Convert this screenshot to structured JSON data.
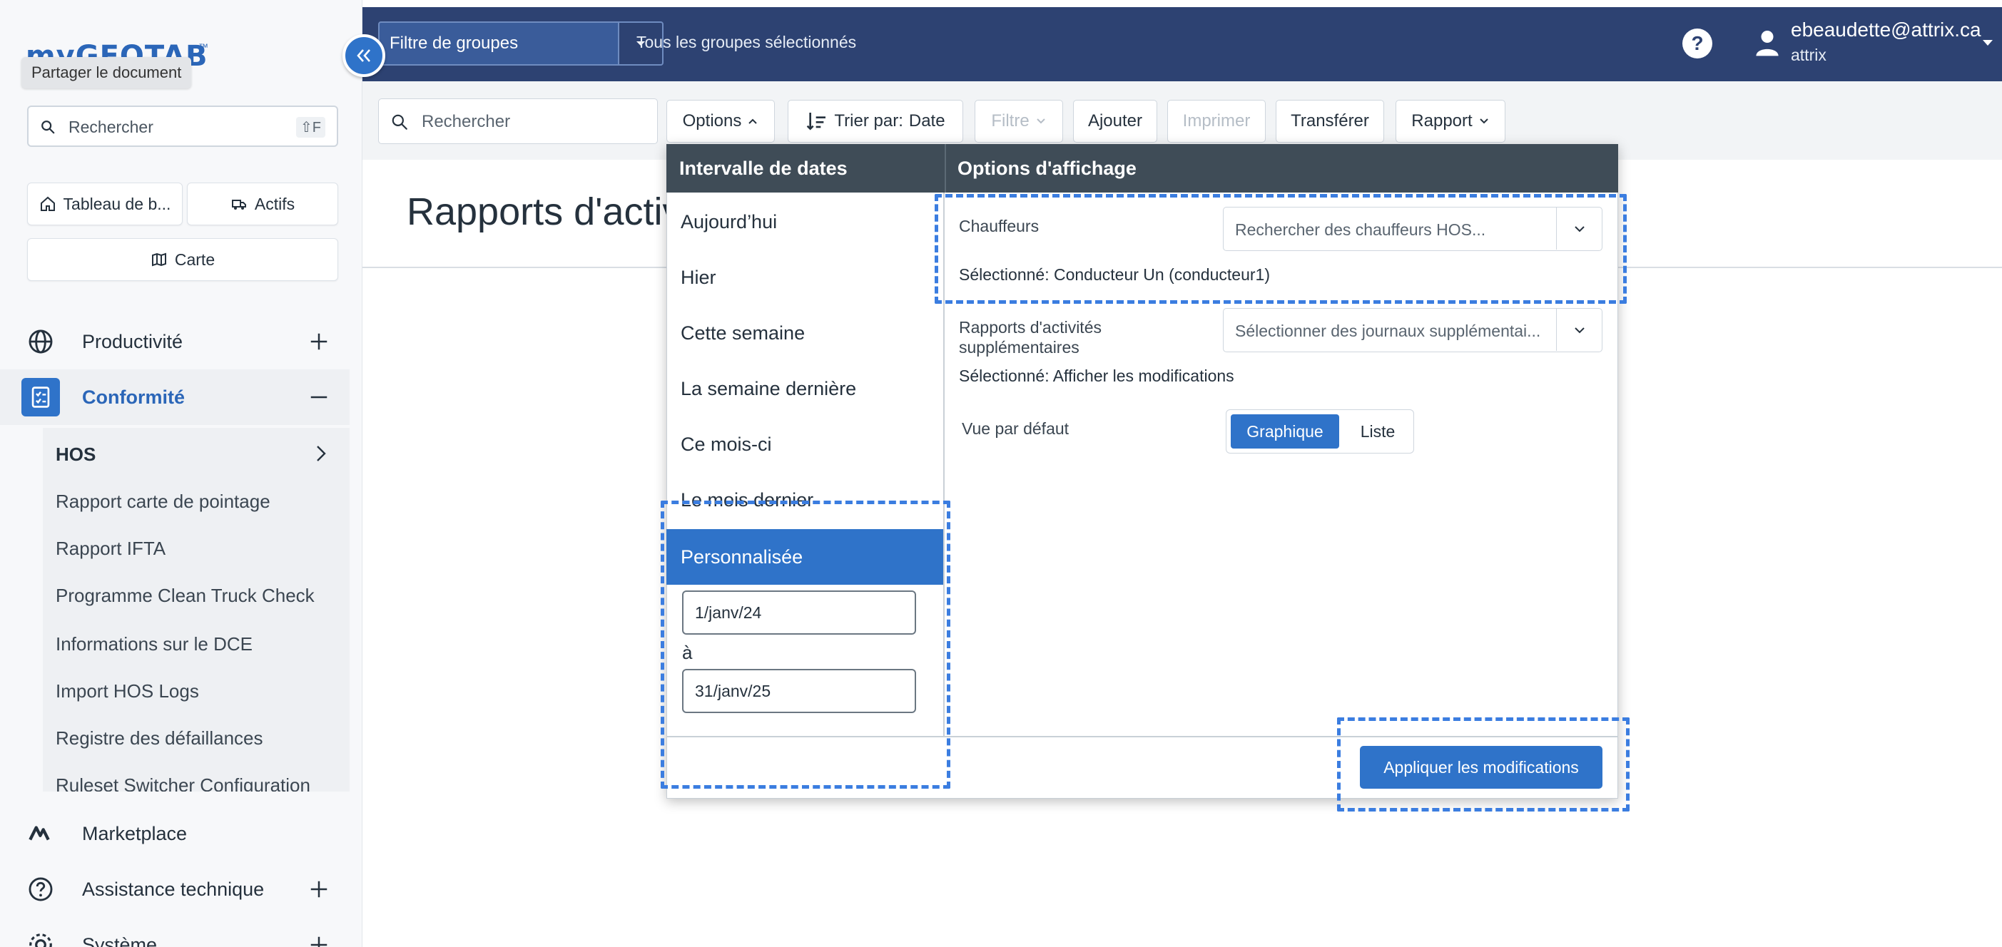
{
  "sidebar": {
    "logo": "myGEOTAB",
    "logo_tm": "™",
    "share_tooltip": "Partager le document",
    "search": {
      "placeholder": "Rechercher",
      "shortcut": "⇧F"
    },
    "quick": {
      "dashboard": "Tableau de b...",
      "assets": "Actifs",
      "map": "Carte"
    },
    "nav": {
      "productivity": "Productivité",
      "compliance": "Conformité",
      "marketplace": "Marketplace",
      "support": "Assistance technique",
      "system": "Système"
    },
    "compliance_items": [
      "HOS",
      "Rapport carte de pointage",
      "Rapport IFTA",
      "Programme Clean Truck Check",
      "Informations sur le DCE",
      "Import HOS Logs",
      "Registre des défaillances",
      "Ruleset Switcher Configuration"
    ]
  },
  "topbar": {
    "group_filter": "Filtre de groupes",
    "group_status": "Tous les groupes sélectionnés",
    "help": "?",
    "user_email": "ebeaudette@attrix.ca",
    "user_db": "attrix"
  },
  "toolbar": {
    "search_placeholder": "Rechercher",
    "options": "Options",
    "sort_label": "Trier par:",
    "sort_value": "Date",
    "filter": "Filtre",
    "add": "Ajouter",
    "print": "Imprimer",
    "transfer": "Transférer",
    "report": "Rapport"
  },
  "page": {
    "title": "Rapports d'activ"
  },
  "options_panel": {
    "date_header": "Intervalle de dates",
    "display_header": "Options d'affichage",
    "dates": [
      "Aujourd’hui",
      "Hier",
      "Cette semaine",
      "La semaine dernière",
      "Ce mois-ci",
      "Le mois dernier",
      "Personnalisée"
    ],
    "from": "1/janv/24",
    "to_label": "à",
    "to": "31/janv/25",
    "drivers_label": "Chauffeurs",
    "drivers_placeholder": "Rechercher des chauffeurs HOS...",
    "drivers_selected": "Sélectionné: Conducteur Un (conducteur1)",
    "extra_label_1": "Rapports d'activités",
    "extra_label_2": "supplémentaires",
    "extra_placeholder": "Sélectionner des journaux supplémentai...",
    "extra_selected": "Sélectionné: Afficher les modifications",
    "default_view_label": "Vue par défaut",
    "view_graph": "Graphique",
    "view_list": "Liste",
    "apply": "Appliquer les modifications"
  },
  "colors": {
    "topbar": "#2d4272",
    "accent": "#2f73c9",
    "panel_header": "#3f4c57",
    "highlight_dash": "#3b7de0"
  }
}
